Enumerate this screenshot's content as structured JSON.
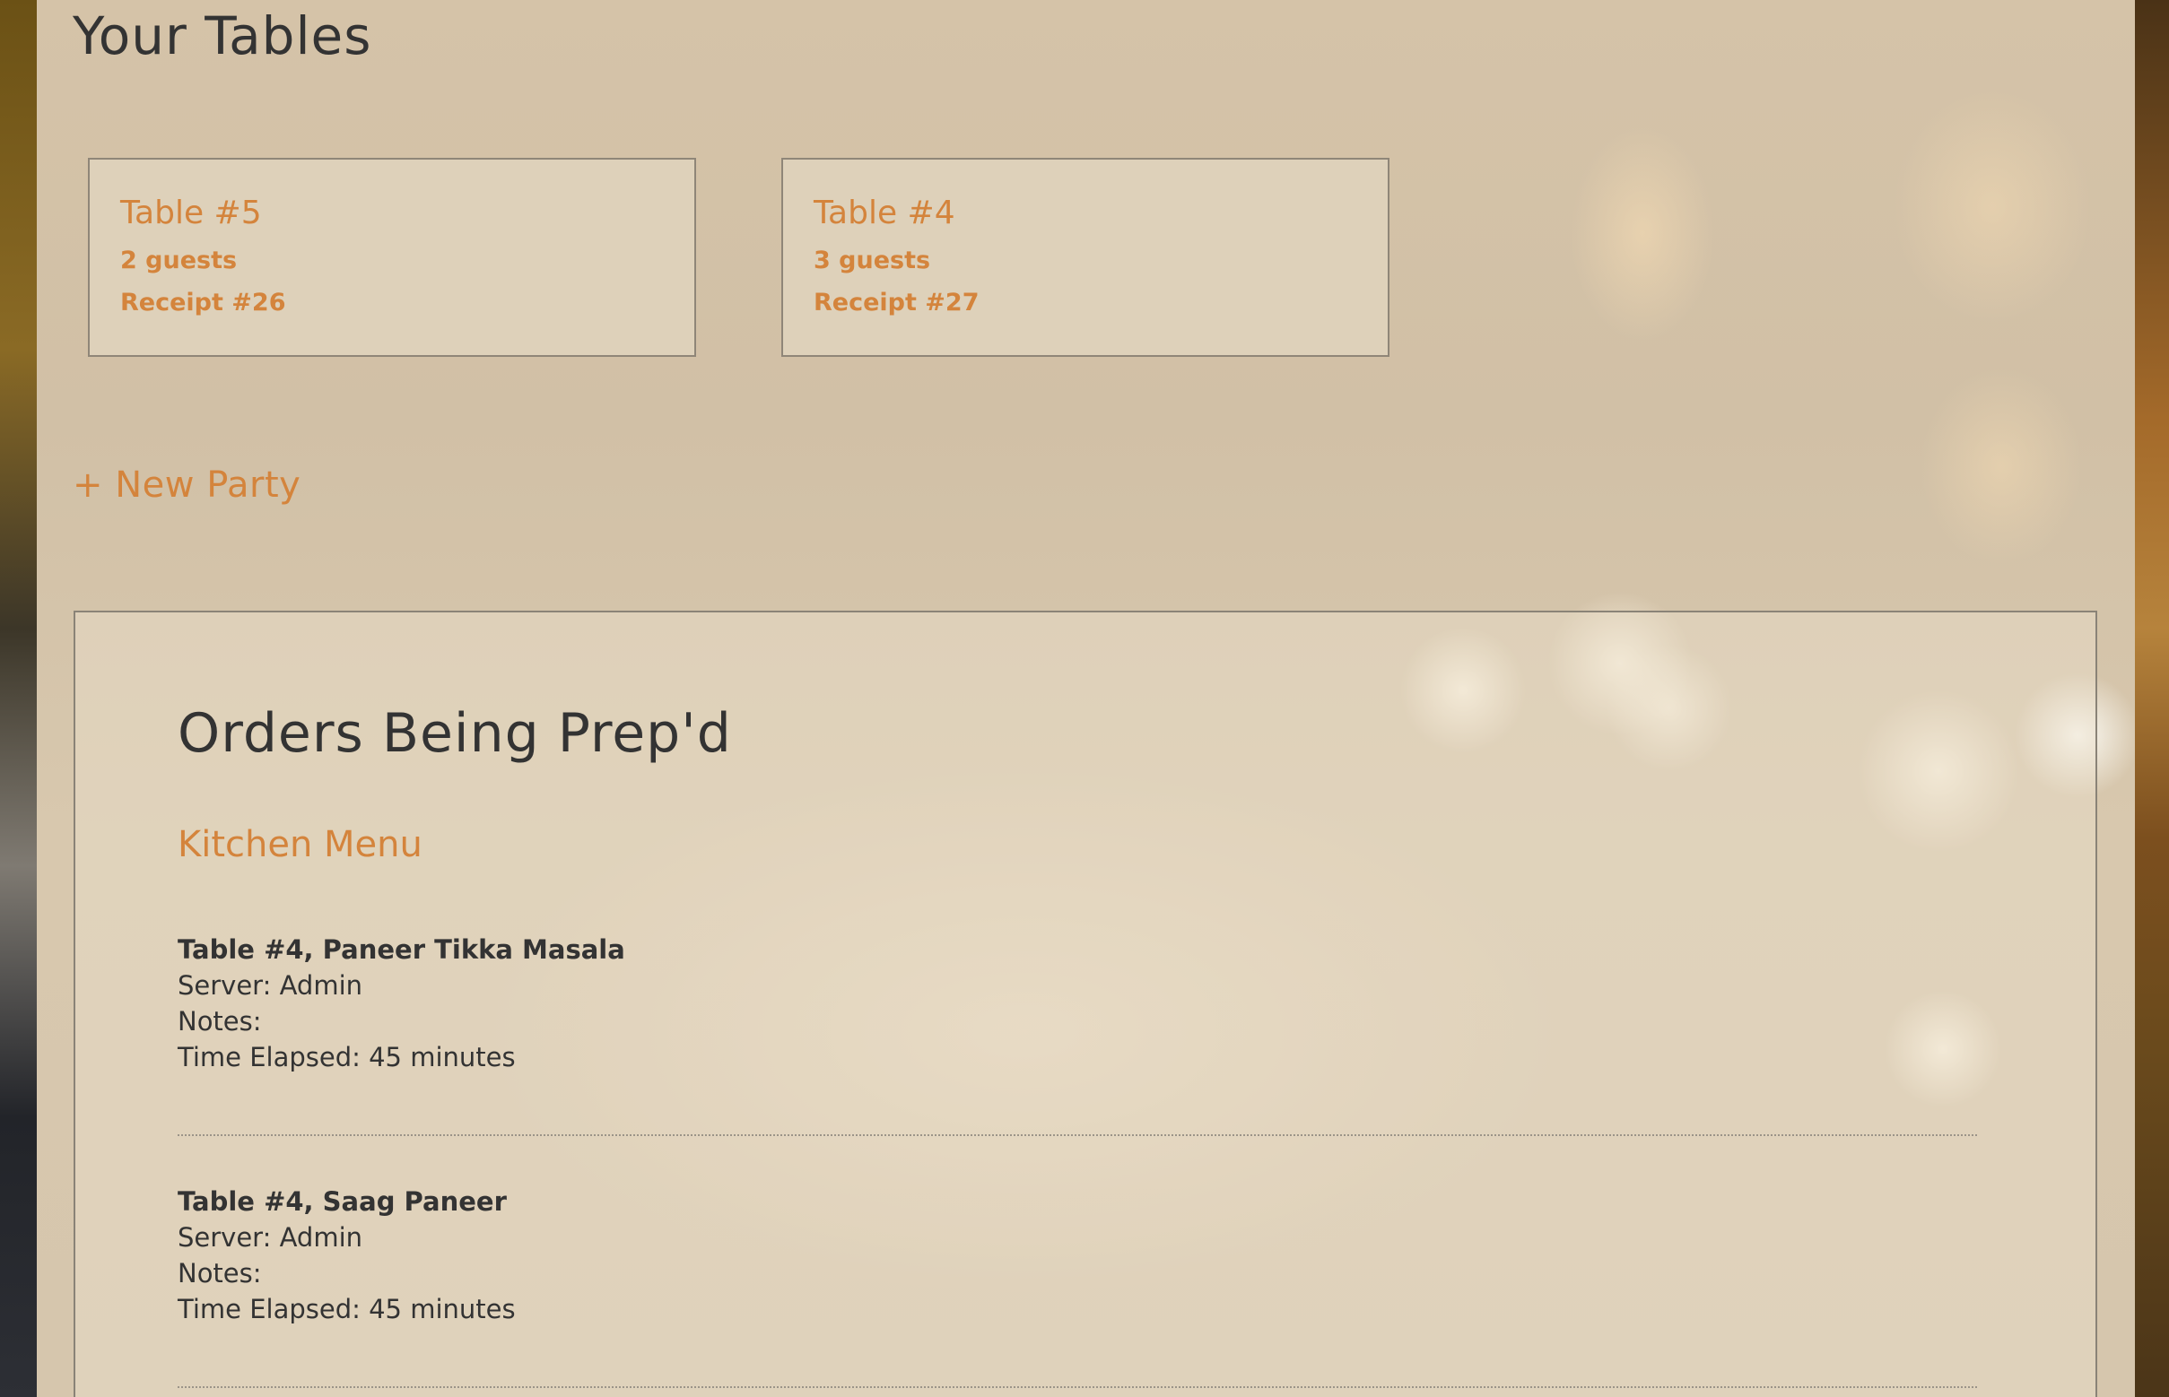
{
  "header": {
    "title": "Your Tables"
  },
  "tables": [
    {
      "name": "Table #5",
      "guests": "2 guests",
      "receipt": "Receipt #26"
    },
    {
      "name": "Table #4",
      "guests": "3 guests",
      "receipt": "Receipt #27"
    }
  ],
  "actions": {
    "new_party": "+ New Party"
  },
  "orders": {
    "title": "Orders Being Prep'd",
    "kitchen_menu_link": "Kitchen Menu",
    "items": [
      {
        "heading": "Table #4, Paneer Tikka Masala",
        "server": "Server: Admin",
        "notes": "Notes:",
        "elapsed": "Time Elapsed: 45 minutes"
      },
      {
        "heading": "Table #4, Saag Paneer",
        "server": "Server: Admin",
        "notes": "Notes:",
        "elapsed": "Time Elapsed: 45 minutes"
      }
    ]
  },
  "colors": {
    "accent": "#d4843c",
    "text": "#333333",
    "border": "#8f8678"
  }
}
